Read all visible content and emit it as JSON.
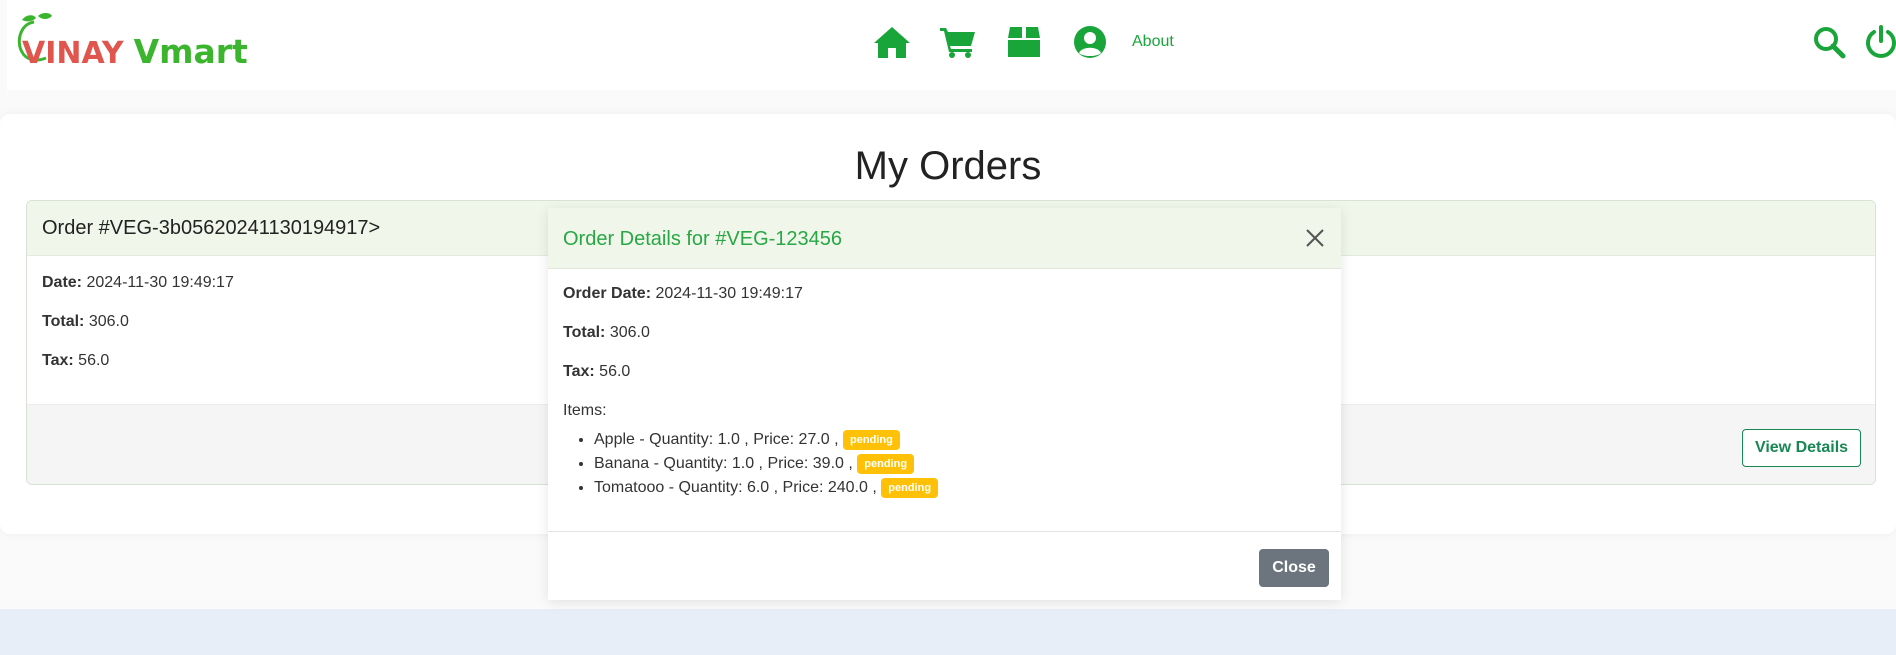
{
  "brand": {
    "part1": "VINAY",
    "part2": "Vmart",
    "color_red": "#e0564f",
    "color_green": "#3cb52e"
  },
  "nav": {
    "icons": [
      "home-icon",
      "cart-icon",
      "box-icon",
      "user-circle-icon"
    ],
    "about_label": "About",
    "right_icons": [
      "search-icon",
      "power-icon"
    ],
    "accent": "#1aa53a"
  },
  "main": {
    "title": "My Orders",
    "order": {
      "header": "Order #VEG-3b05620241130194917>",
      "date_label": "Date:",
      "date_value": "2024-11-30 19:49:17",
      "total_label": "Total:",
      "total_value": "306.0",
      "tax_label": "Tax:",
      "tax_value": "56.0",
      "view_details_label": "View Details"
    }
  },
  "modal": {
    "title": "Order Details for #VEG-123456",
    "order_date_label": "Order Date:",
    "order_date_value": "2024-11-30 19:49:17",
    "total_label": "Total:",
    "total_value": "306.0",
    "tax_label": "Tax:",
    "tax_value": "56.0",
    "items_label": "Items:",
    "items": [
      {
        "text": "Apple - Quantity: 1.0 , Price: 27.0 ,",
        "status": "pending"
      },
      {
        "text": "Banana - Quantity: 1.0 , Price: 39.0 ,",
        "status": "pending"
      },
      {
        "text": "Tomatooo - Quantity: 6.0 , Price: 240.0 ,",
        "status": "pending"
      }
    ],
    "close_label": "Close",
    "status_color": "#ffc107"
  }
}
